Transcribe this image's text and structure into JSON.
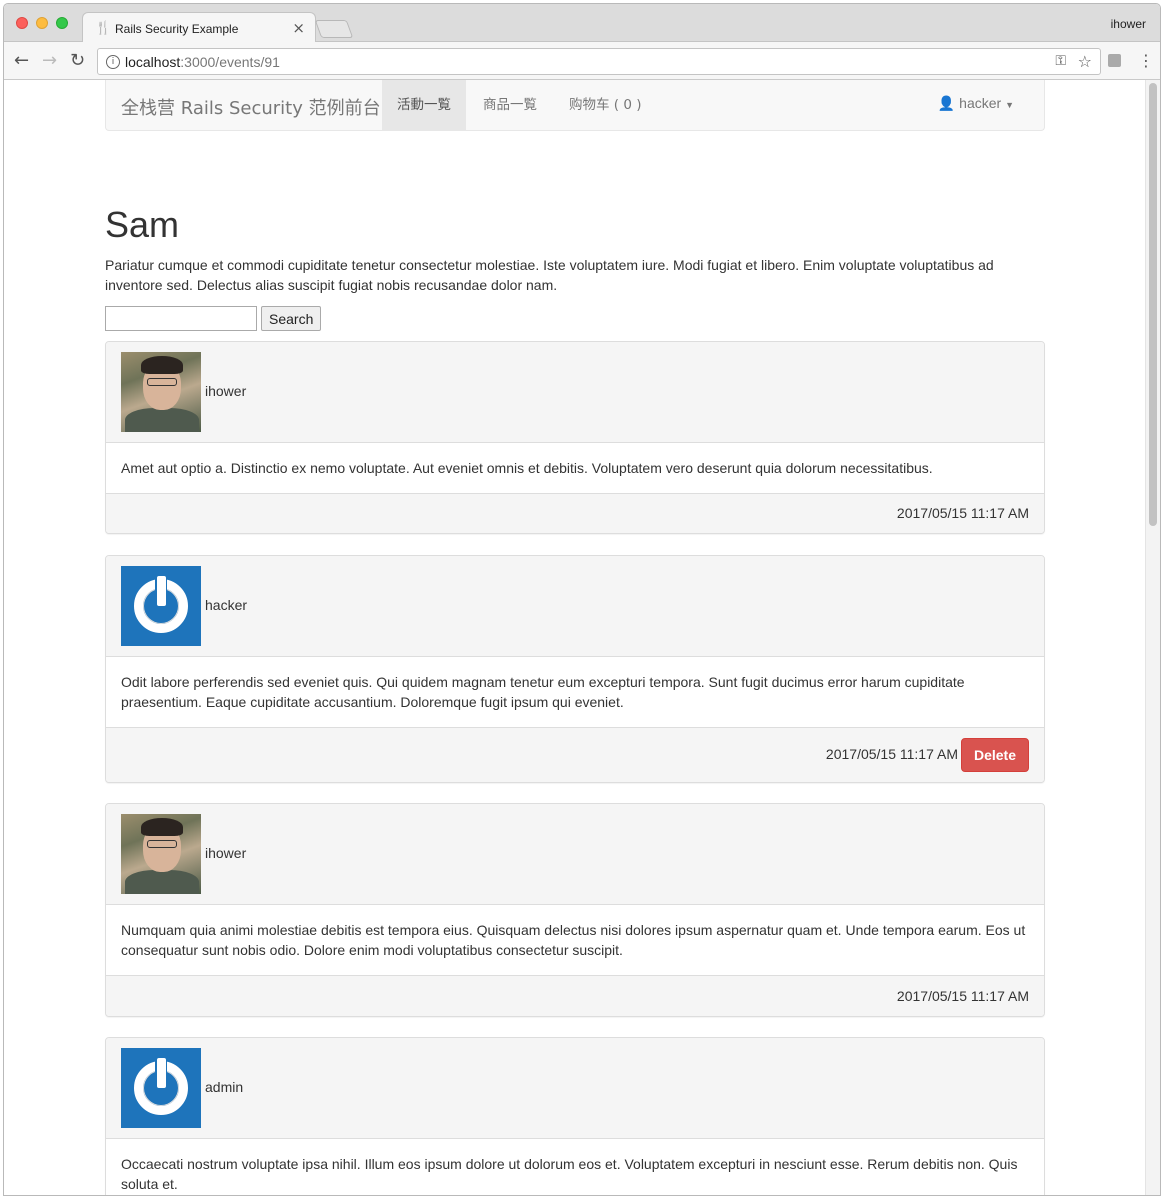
{
  "browser": {
    "tab_title": "Rails Security Example",
    "profile": "ihower",
    "url_host": "localhost",
    "url_path": ":3000/events/91"
  },
  "navbar": {
    "brand": "全栈营 Rails Security 范例前台",
    "items": [
      {
        "label": "活動一覧",
        "active": true
      },
      {
        "label": "商品一覧",
        "active": false
      },
      {
        "label": "购物车 ( 0 )",
        "active": false
      }
    ],
    "user": "hacker"
  },
  "event": {
    "title": "Sam",
    "description": "Pariatur cumque et commodi cupiditate tenetur consectetur molestiae. Iste voluptatem iure. Modi fugiat et libero. Enim voluptate voluptatibus ad inventore sed. Delectus alias suscipit fugiat nobis recusandae dolor nam."
  },
  "search": {
    "value": "",
    "button_label": "Search"
  },
  "comments": [
    {
      "author": "ihower",
      "avatar": "photo",
      "body": "Amet aut optio a. Distinctio ex nemo voluptate. Aut eveniet omnis et debitis. Voluptatem vero deserunt quia dolorum necessitatibus.",
      "timestamp": "2017/05/15 11:17 AM"
    },
    {
      "author": "hacker",
      "avatar": "gravatar",
      "body": "Odit labore perferendis sed eveniet quis. Qui quidem magnam tenetur eum excepturi tempora. Sunt fugit ducimus error harum cupiditate praesentium. Eaque cupiditate accusantium. Doloremque fugit ipsum qui eveniet.",
      "timestamp": "2017/05/15 11:17 AM",
      "delete_label": "Delete"
    },
    {
      "author": "ihower",
      "avatar": "photo",
      "body": "Numquam quia animi molestiae debitis est tempora eius. Quisquam delectus nisi dolores ipsum aspernatur quam et. Unde tempora earum. Eos ut consequatur sunt nobis odio. Dolore enim modi voluptatibus consectetur suscipit.",
      "timestamp": "2017/05/15 11:17 AM"
    },
    {
      "author": "admin",
      "avatar": "gravatar",
      "body": "Occaecati nostrum voluptate ipsa nihil. Illum eos ipsum dolore ut dolorum eos et. Voluptatem excepturi in nesciunt esse. Rerum debitis non. Quis soluta et."
    }
  ],
  "colors": {
    "danger": "#d9534f",
    "gravatar_blue": "#1e74bb"
  }
}
